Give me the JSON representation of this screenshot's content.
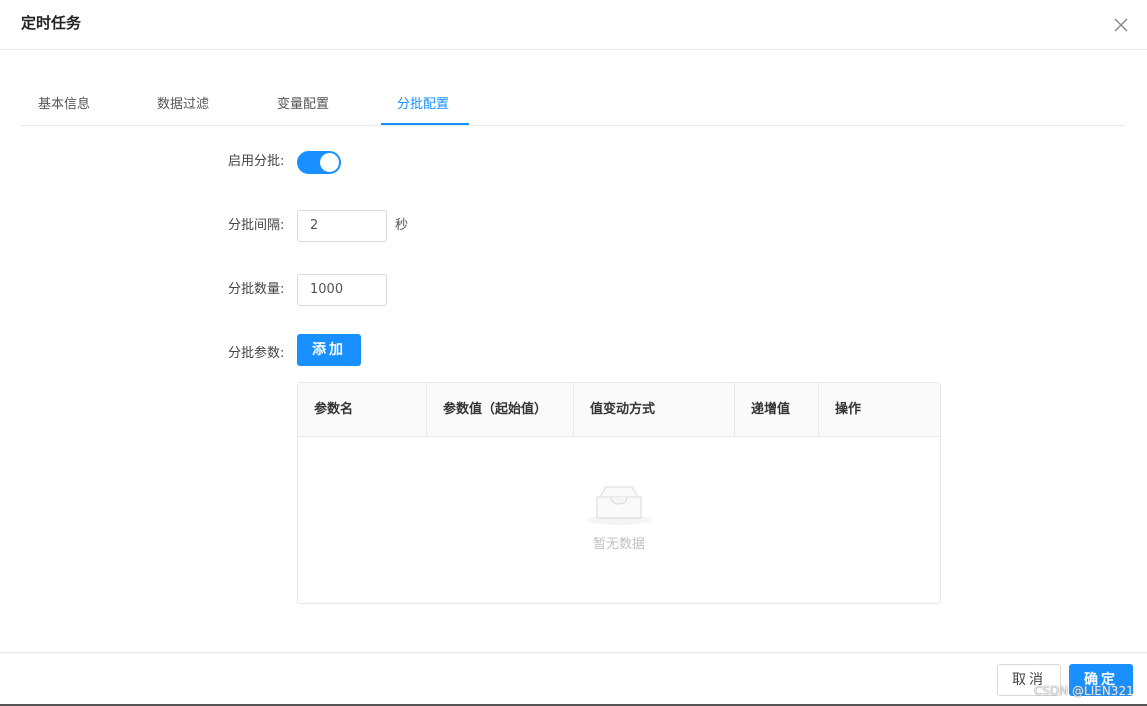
{
  "dialog": {
    "title": "定时任务"
  },
  "tabs": [
    {
      "label": "基本信息",
      "active": false
    },
    {
      "label": "数据过滤",
      "active": false
    },
    {
      "label": "变量配置",
      "active": false
    },
    {
      "label": "分批配置",
      "active": true
    }
  ],
  "form": {
    "enable_label": "启用分批:",
    "enable_value": true,
    "interval_label": "分批间隔:",
    "interval_value": "2",
    "interval_unit": "秒",
    "count_label": "分批数量:",
    "count_value": "1000",
    "params_label": "分批参数:",
    "add_button": "添加"
  },
  "params_table": {
    "columns": [
      "参数名",
      "参数值（起始值）",
      "值变动方式",
      "递增值",
      "操作"
    ],
    "rows": [],
    "empty_text": "暂无数据"
  },
  "footer": {
    "cancel_label": "取消",
    "ok_label": "确定"
  },
  "watermark": "CSDN @LIEN321",
  "colors": {
    "accent": "#1890ff",
    "border": "#e8e8e8",
    "header_bg": "#fafafa"
  },
  "icons": {
    "close": "close-icon",
    "empty": "empty-inbox-icon"
  }
}
